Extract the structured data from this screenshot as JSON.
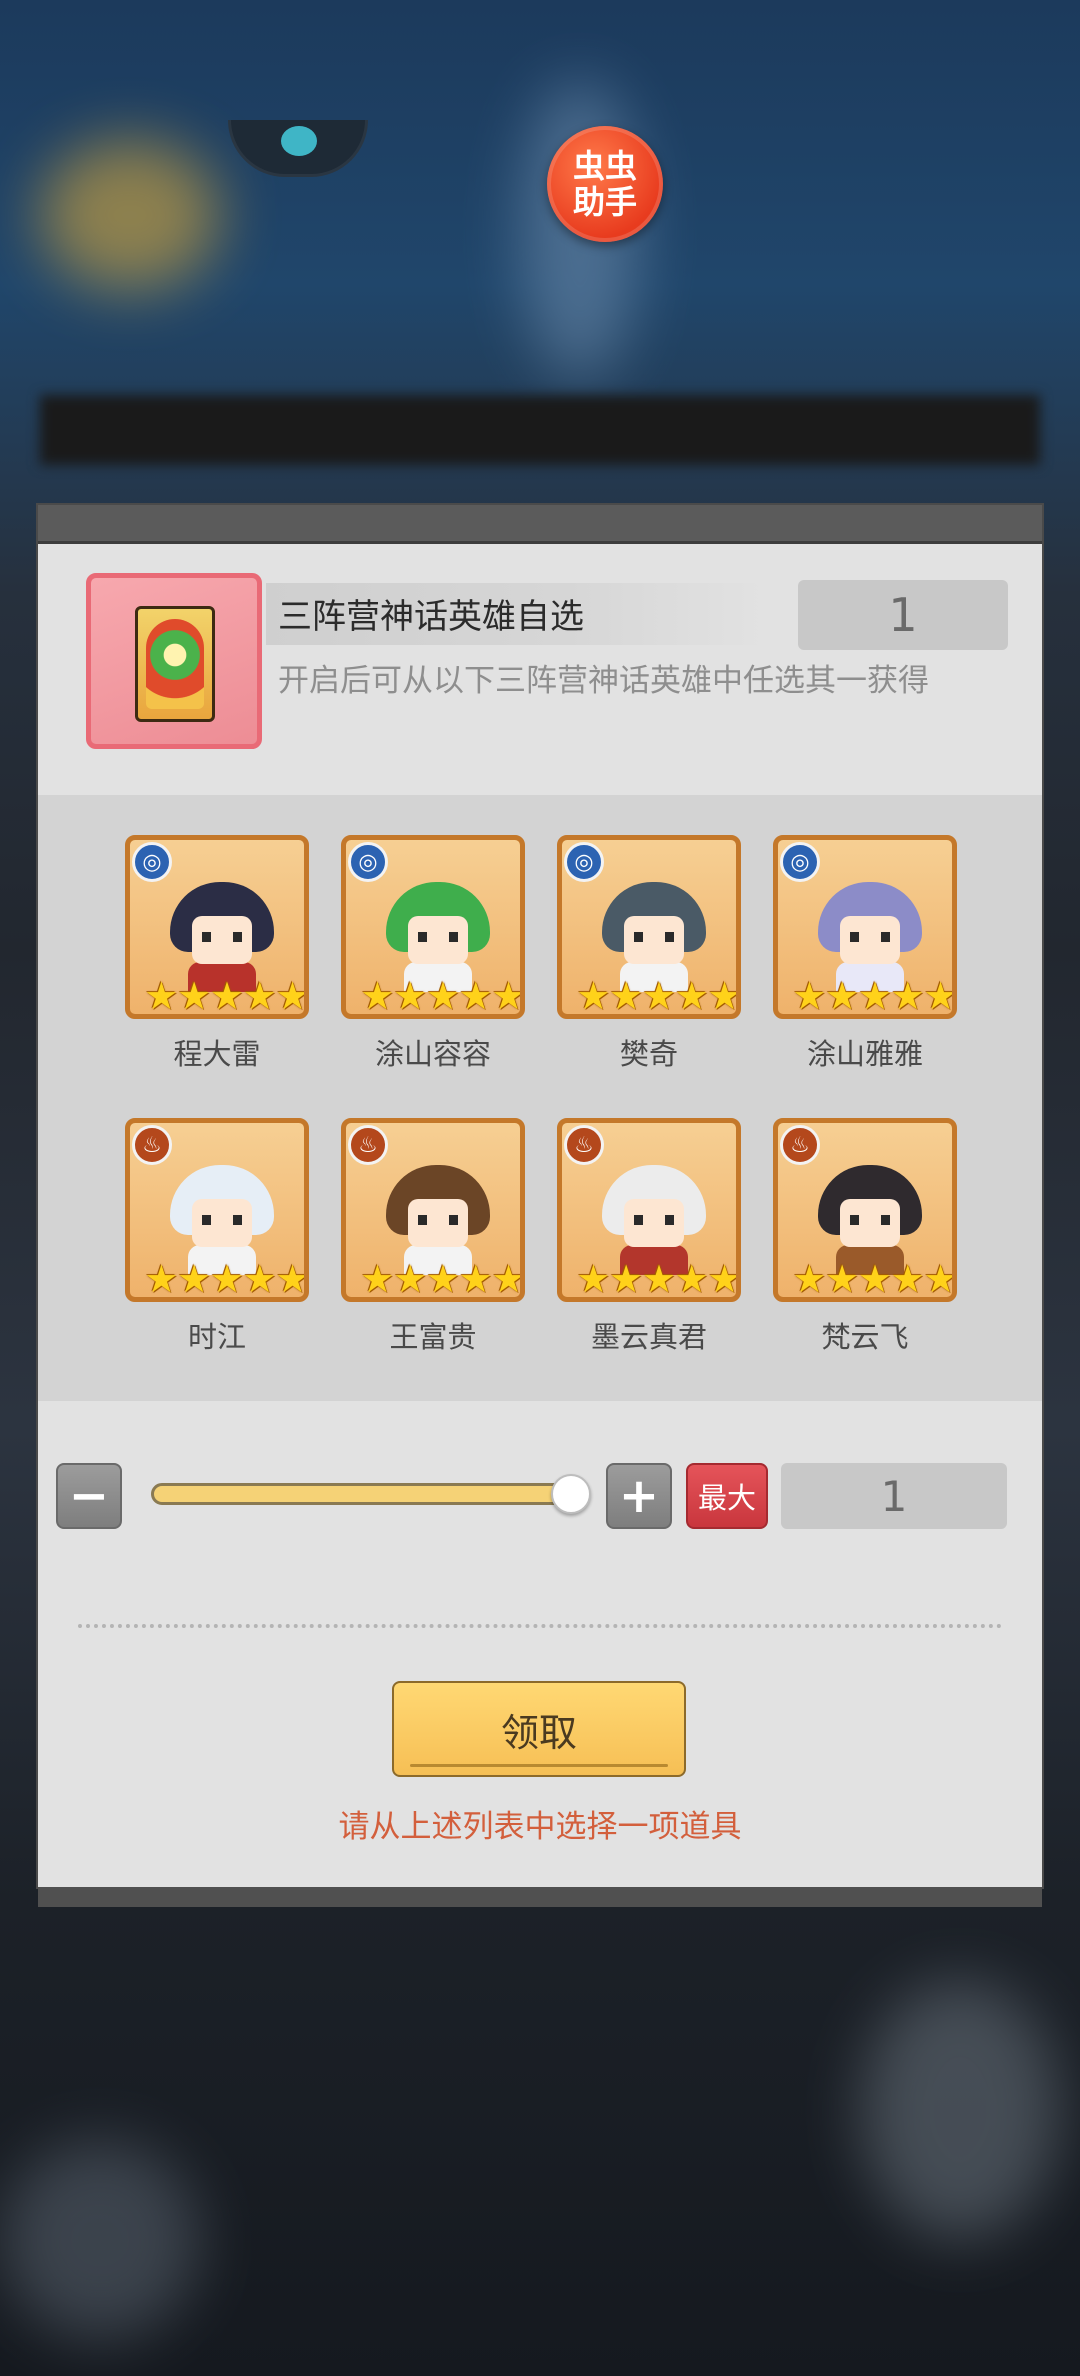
{
  "assistant": {
    "line1": "虫虫",
    "line2": "助手",
    "icon": "chongchong-assistant-icon"
  },
  "item": {
    "title": "三阵营神话英雄自选",
    "count": "1",
    "description": "开启后可从以下三阵营神话英雄中任选其一获得",
    "icon": "hero-selection-card-icon"
  },
  "heroes": [
    {
      "name": "程大雷",
      "faction": "water",
      "stars": 5,
      "hair": "#2b2d45",
      "outfit": "#b8322b"
    },
    {
      "name": "涂山容容",
      "faction": "water",
      "stars": 5,
      "hair": "#3fae4c",
      "outfit": "#f3f3f3"
    },
    {
      "name": "樊奇",
      "faction": "water",
      "stars": 5,
      "hair": "#4a5a66",
      "outfit": "#f3f3f3"
    },
    {
      "name": "涂山雅雅",
      "faction": "water",
      "stars": 5,
      "hair": "#8c8cc8",
      "outfit": "#e8e8f8"
    },
    {
      "name": "时江",
      "faction": "fire",
      "stars": 5,
      "hair": "#e6eef6",
      "outfit": "#f3f3f3"
    },
    {
      "name": "王富贵",
      "faction": "fire",
      "stars": 5,
      "hair": "#6b4526",
      "outfit": "#f3f3f3"
    },
    {
      "name": "墨云真君",
      "faction": "fire",
      "stars": 5,
      "hair": "#ececec",
      "outfit": "#b3362c"
    },
    {
      "name": "梵云飞",
      "faction": "fire",
      "stars": 5,
      "hair": "#2f2a2e",
      "outfit": "#9a5a2a"
    }
  ],
  "controls": {
    "minus_icon": "minus-icon",
    "plus_icon": "plus-icon",
    "max_label": "最大",
    "quantity": "1",
    "slider_fraction": 1.0
  },
  "claim_label": "领取",
  "hint": "请从上述列表中选择一项道具",
  "colors": {
    "star": "#ffd21a",
    "tile_border": "#c4782a",
    "claim_button": "#f6bf55",
    "max_button": "#c9363d",
    "hint_text": "#d35f3c"
  }
}
